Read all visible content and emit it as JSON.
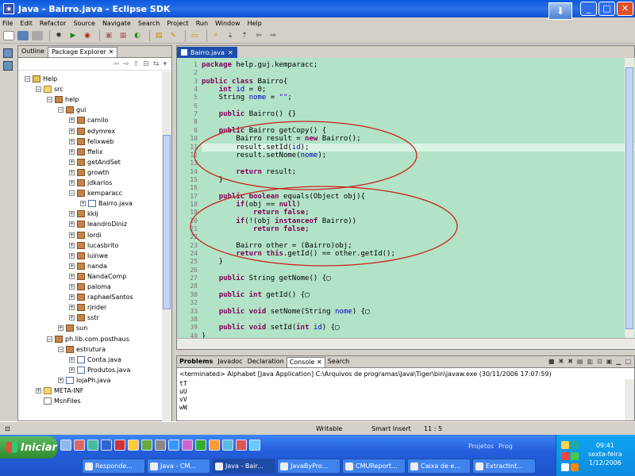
{
  "window": {
    "title": "Java - Bairro.java - Eclipse SDK",
    "title_icon": "eclipse-icon",
    "minimize": "_",
    "maximize": "□",
    "close": "✕",
    "download_icon": "download-arrow-icon"
  },
  "menu": [
    "File",
    "Edit",
    "Refactor",
    "Source",
    "Navigate",
    "Search",
    "Project",
    "Run",
    "Window",
    "Help"
  ],
  "toolbar_icons": [
    "new",
    "save",
    "print",
    "debug",
    "run",
    "external-tools",
    "new-java-project",
    "new-package",
    "new-class",
    "open-type",
    "search",
    "toggle-mark",
    "next-annotation",
    "previous-annotation",
    "back",
    "forward"
  ],
  "explorer": {
    "tabs": {
      "outline": "Outline",
      "package_explorer": "Package Explorer",
      "close": "✕"
    },
    "tree": [
      {
        "label": "Help",
        "depth": 0,
        "icon": "project",
        "toggle": "−"
      },
      {
        "label": "src",
        "depth": 1,
        "icon": "folder",
        "toggle": "−"
      },
      {
        "label": "help",
        "depth": 2,
        "icon": "package",
        "toggle": "−"
      },
      {
        "label": "gui",
        "depth": 3,
        "icon": "package",
        "toggle": "−"
      },
      {
        "label": "camilo",
        "depth": 4,
        "icon": "package",
        "toggle": "+"
      },
      {
        "label": "edymrex",
        "depth": 4,
        "icon": "package",
        "toggle": "+"
      },
      {
        "label": "felixweb",
        "depth": 4,
        "icon": "package",
        "toggle": "+"
      },
      {
        "label": "ffelix",
        "depth": 4,
        "icon": "package",
        "toggle": "+"
      },
      {
        "label": "getAndSet",
        "depth": 4,
        "icon": "package",
        "toggle": "+"
      },
      {
        "label": "growth",
        "depth": 4,
        "icon": "package",
        "toggle": "+"
      },
      {
        "label": "jdkarlos",
        "depth": 4,
        "icon": "package",
        "toggle": "+"
      },
      {
        "label": "kemparacc",
        "depth": 4,
        "icon": "package",
        "toggle": "−"
      },
      {
        "label": "Bairro.java",
        "depth": 5,
        "icon": "java",
        "toggle": "+"
      },
      {
        "label": "kklj",
        "depth": 4,
        "icon": "package",
        "toggle": "+"
      },
      {
        "label": "leandroDiniz",
        "depth": 4,
        "icon": "package",
        "toggle": "+"
      },
      {
        "label": "lordi",
        "depth": 4,
        "icon": "package",
        "toggle": "+"
      },
      {
        "label": "lucasbrito",
        "depth": 4,
        "icon": "package",
        "toggle": "+"
      },
      {
        "label": "luinwe",
        "depth": 4,
        "icon": "package",
        "toggle": "+"
      },
      {
        "label": "nanda",
        "depth": 4,
        "icon": "package",
        "toggle": "+"
      },
      {
        "label": "NandaComp",
        "depth": 4,
        "icon": "package",
        "toggle": "+"
      },
      {
        "label": "paloma",
        "depth": 4,
        "icon": "package",
        "toggle": "+"
      },
      {
        "label": "raphaelSantos",
        "depth": 4,
        "icon": "package",
        "toggle": "+"
      },
      {
        "label": "rjrider",
        "depth": 4,
        "icon": "package",
        "toggle": "+"
      },
      {
        "label": "sstr",
        "depth": 4,
        "icon": "package",
        "toggle": "+"
      },
      {
        "label": "sun",
        "depth": 3,
        "icon": "package",
        "toggle": "+"
      },
      {
        "label": "ph.lib.com.posthaus",
        "depth": 2,
        "icon": "package",
        "toggle": "−"
      },
      {
        "label": "estrutura",
        "depth": 3,
        "icon": "package",
        "toggle": "−"
      },
      {
        "label": "Conta.java",
        "depth": 4,
        "icon": "java",
        "toggle": "+"
      },
      {
        "label": "Produtos.java",
        "depth": 4,
        "icon": "java",
        "toggle": "+"
      },
      {
        "label": "lojaPh.java",
        "depth": 3,
        "icon": "java",
        "toggle": "+"
      },
      {
        "label": "META-INF",
        "depth": 1,
        "icon": "folder",
        "toggle": "+"
      },
      {
        "label": "MsnFiles",
        "depth": 1,
        "icon": "file",
        "toggle": ""
      }
    ]
  },
  "editor": {
    "tab": "Bairro.java",
    "tab_close": "✕",
    "lines": [
      {
        "n": "1",
        "code": "package help.guj.kemparacc;"
      },
      {
        "n": "2",
        "code": ""
      },
      {
        "n": "3",
        "code": "public class Bairro{"
      },
      {
        "n": "4",
        "code": "    int id = 0;"
      },
      {
        "n": "5",
        "code": "    String nome = \"\";"
      },
      {
        "n": "6",
        "code": ""
      },
      {
        "n": "7",
        "code": "    public Bairro() {}"
      },
      {
        "n": "8",
        "code": ""
      },
      {
        "n": "9",
        "code": "    public Bairro getCopy() {"
      },
      {
        "n": "10",
        "code": "        Bairro result = new Bairro();"
      },
      {
        "n": "11",
        "code": "        result.setId(id);"
      },
      {
        "n": "12",
        "code": "        result.setNome(nome);"
      },
      {
        "n": "13",
        "code": ""
      },
      {
        "n": "14",
        "code": "        return result;"
      },
      {
        "n": "15",
        "code": "    }"
      },
      {
        "n": "16",
        "code": ""
      },
      {
        "n": "17",
        "code": "    public boolean equals(Object obj){"
      },
      {
        "n": "18",
        "code": "        if(obj == null)"
      },
      {
        "n": "19",
        "code": "            return false;"
      },
      {
        "n": "20",
        "code": "        if(!(obj instanceof Bairro))"
      },
      {
        "n": "21",
        "code": "            return false;"
      },
      {
        "n": "22",
        "code": ""
      },
      {
        "n": "23",
        "code": "        Bairro other = (Bairro)obj;"
      },
      {
        "n": "24",
        "code": "        return this.getId() == other.getId();"
      },
      {
        "n": "25",
        "code": "    }"
      },
      {
        "n": "26",
        "code": ""
      },
      {
        "n": "27",
        "code": "    public String getNome() {▢"
      },
      {
        "n": "28",
        "code": ""
      },
      {
        "n": "30",
        "code": "    public int getId() {▢"
      },
      {
        "n": "32",
        "code": ""
      },
      {
        "n": "33",
        "code": "    public void setNome(String nome) {▢"
      },
      {
        "n": "38",
        "code": ""
      },
      {
        "n": "39",
        "code": "    public void setId(int id) {▢"
      },
      {
        "n": "40",
        "code": "}"
      },
      {
        "n": "41",
        "code": ""
      },
      {
        "n": "42",
        "code": ""
      },
      {
        "n": "43",
        "code": ""
      }
    ],
    "highlighted_line": "11"
  },
  "console": {
    "tabs": [
      "Problems",
      "Javadoc",
      "Declaration",
      "Console",
      "Search"
    ],
    "active_tab": "Console",
    "tab_close": "✕",
    "header": "<terminated> Alphabet [Java Application] C:\\Arquivos de programas\\Java\\Tiger\\bin\\javaw.exe (30/11/2006 17:07:59)",
    "lines": [
      "tT",
      "uU",
      "vV",
      "wW"
    ]
  },
  "status": {
    "writable": "Writable",
    "insert_mode": "Smart Insert",
    "position": "11 : 5"
  },
  "taskbar": {
    "start": "Iniciar",
    "buttons": [
      "Responde...",
      "Java - CM...",
      "Java - Bair...",
      "JavaByPro...",
      "CMUReport...",
      "Caixa de e...",
      "ExtractInt..."
    ],
    "active_button": "Java - Bair...",
    "projects": "Projetos",
    "prog": "Prog",
    "clock": {
      "time": "09:41",
      "day": "sexta-feira",
      "date": "1/12/2006"
    }
  }
}
